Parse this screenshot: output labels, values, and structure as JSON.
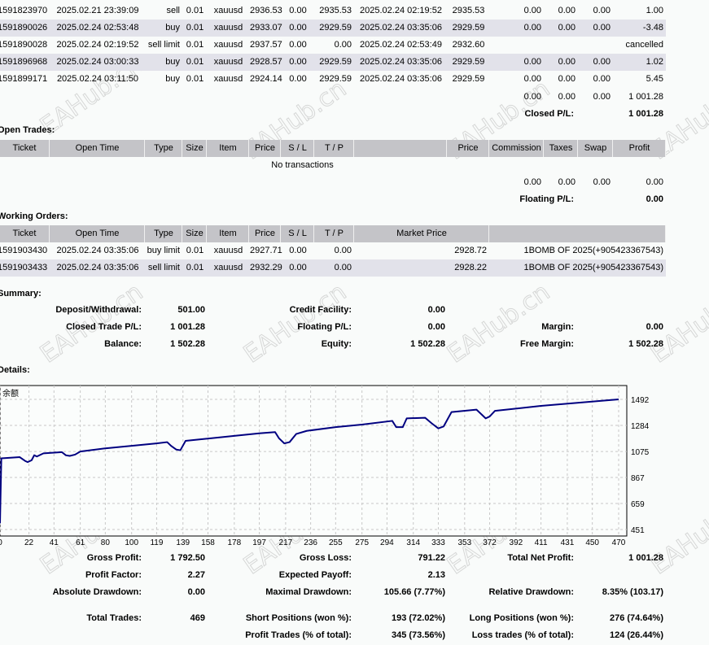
{
  "closed_trades": {
    "rows": [
      [
        "1591823970",
        "2025.02.21 23:39:09",
        "sell",
        "0.01",
        "xauusd",
        "2936.53",
        "0.00",
        "2935.53",
        "2025.02.24 02:19:52",
        "2935.53",
        "0.00",
        "0.00",
        "0.00",
        "1.00"
      ],
      [
        "1591890026",
        "2025.02.24 02:53:48",
        "buy",
        "0.01",
        "xauusd",
        "2933.07",
        "0.00",
        "2929.59",
        "2025.02.24 03:35:06",
        "2929.59",
        "0.00",
        "0.00",
        "0.00",
        "-3.48"
      ],
      [
        "1591890028",
        "2025.02.24 02:19:52",
        "sell limit",
        "0.01",
        "xauusd",
        "2937.57",
        "0.00",
        "0.00",
        "2025.02.24 02:53:49",
        "2932.60",
        "",
        "",
        "",
        "cancelled"
      ],
      [
        "1591896968",
        "2025.02.24 03:00:33",
        "buy",
        "0.01",
        "xauusd",
        "2928.57",
        "0.00",
        "2929.59",
        "2025.02.24 03:35:06",
        "2929.59",
        "0.00",
        "0.00",
        "0.00",
        "1.02"
      ],
      [
        "1591899171",
        "2025.02.24 03:11:50",
        "buy",
        "0.01",
        "xauusd",
        "2924.14",
        "0.00",
        "2929.59",
        "2025.02.24 03:35:06",
        "2929.59",
        "0.00",
        "0.00",
        "0.00",
        "5.45"
      ]
    ],
    "totals": [
      "0.00",
      "0.00",
      "0.00",
      "1 001.28"
    ],
    "closed_pl_label": "Closed P/L:",
    "closed_pl_value": "1 001.28"
  },
  "open_trades": {
    "title": "Open Trades:",
    "headers": [
      "Ticket",
      "Open Time",
      "Type",
      "Size",
      "Item",
      "Price",
      "S / L",
      "T / P",
      "",
      "Price",
      "Commission",
      "Taxes",
      "Swap",
      "Profit"
    ],
    "empty_text": "No transactions",
    "totals": [
      "0.00",
      "0.00",
      "0.00",
      "0.00"
    ],
    "floating_pl_label": "Floating P/L:",
    "floating_pl_value": "0.00"
  },
  "working_orders": {
    "title": "Working Orders:",
    "headers": [
      "Ticket",
      "Open Time",
      "Type",
      "Size",
      "Item",
      "Price",
      "S / L",
      "T / P",
      "Market Price",
      ""
    ],
    "rows": [
      [
        "1591903430",
        "2025.02.24 03:35:06",
        "buy limit",
        "0.01",
        "xauusd",
        "2927.71",
        "0.00",
        "0.00",
        "2928.72",
        "1BOMB OF 2025(+905423367543)"
      ],
      [
        "1591903433",
        "2025.02.24 03:35:06",
        "sell limit",
        "0.01",
        "xauusd",
        "2932.29",
        "0.00",
        "0.00",
        "2928.22",
        "1BOMB OF 2025(+905423367543)"
      ]
    ]
  },
  "summary": {
    "title": "Summary:",
    "items": [
      {
        "label": "Deposit/Withdrawal:",
        "value": "501.00"
      },
      {
        "label": "Credit Facility:",
        "value": "0.00"
      },
      {
        "label": "Closed Trade P/L:",
        "value": "1 001.28"
      },
      {
        "label": "Floating P/L:",
        "value": "0.00"
      },
      {
        "label": "Margin:",
        "value": "0.00"
      },
      {
        "label": "Balance:",
        "value": "1 502.28"
      },
      {
        "label": "Equity:",
        "value": "1 502.28"
      },
      {
        "label": "Free Margin:",
        "value": "1 502.28"
      }
    ]
  },
  "details": {
    "title": "Details:",
    "stats": [
      {
        "label": "Gross Profit:",
        "value": "1 792.50"
      },
      {
        "label": "Gross Loss:",
        "value": "791.22"
      },
      {
        "label": "Total Net Profit:",
        "value": "1 001.28"
      },
      {
        "label": "Profit Factor:",
        "value": "2.27"
      },
      {
        "label": "Expected Payoff:",
        "value": "2.13"
      },
      {
        "label": "Absolute Drawdown:",
        "value": "0.00"
      },
      {
        "label": "Maximal Drawdown:",
        "value": "105.66 (7.77%)"
      },
      {
        "label": "Relative Drawdown:",
        "value": "8.35% (103.17)"
      },
      {
        "label": "Total Trades:",
        "value": "469"
      },
      {
        "label": "Short Positions (won %):",
        "value": "193 (72.02%)"
      },
      {
        "label": "Long Positions (won %):",
        "value": "276 (74.64%)"
      },
      {
        "label": "Profit Trades (% of total):",
        "value": "345 (73.56%)"
      },
      {
        "label": "Loss trades (% of total):",
        "value": "124 (26.44%)"
      }
    ]
  },
  "chart_data": {
    "type": "line",
    "series": [
      {
        "name": "余额",
        "color": "#000080",
        "x": [
          0,
          1,
          15,
          19,
          21,
          24,
          26,
          28,
          33,
          47,
          50,
          53,
          57,
          61,
          80,
          100,
          119,
          127,
          130,
          134,
          137,
          141,
          150,
          178,
          197,
          209,
          212,
          216,
          220,
          225,
          233,
          255,
          275,
          298,
          301,
          306,
          309,
          323,
          328,
          333,
          337,
          343,
          362,
          366,
          369,
          372,
          376,
          411,
          470
        ],
        "y": [
          501,
          1020,
          1030,
          1000,
          990,
          1005,
          1045,
          1035,
          1060,
          1070,
          1045,
          1040,
          1050,
          1075,
          1100,
          1120,
          1140,
          1150,
          1120,
          1090,
          1085,
          1160,
          1170,
          1200,
          1220,
          1230,
          1180,
          1140,
          1150,
          1215,
          1240,
          1270,
          1290,
          1320,
          1270,
          1270,
          1340,
          1345,
          1300,
          1260,
          1275,
          1390,
          1410,
          1370,
          1340,
          1355,
          1400,
          1440,
          1492
        ]
      }
    ],
    "yticks": [
      451,
      659,
      867,
      1075,
      1284,
      1492
    ],
    "xticks": [
      0,
      22,
      41,
      61,
      80,
      100,
      119,
      139,
      158,
      178,
      197,
      217,
      236,
      255,
      275,
      294,
      314,
      333,
      353,
      372,
      392,
      411,
      431,
      450,
      470
    ],
    "ylim": [
      451,
      1492
    ],
    "xlim": [
      0,
      470
    ],
    "grid": true,
    "colors": {
      "line": "#000080",
      "grid": "#c8c8c8"
    }
  },
  "watermark": "EAHub.cn"
}
